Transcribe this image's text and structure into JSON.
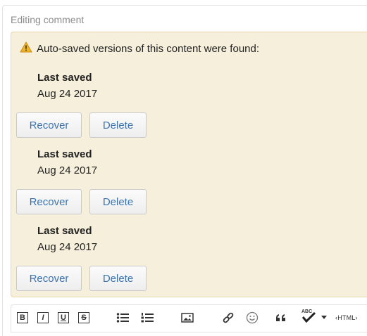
{
  "editor": {
    "title": "Editing comment"
  },
  "notice": {
    "message": "Auto-saved versions of this content were found:",
    "versions": [
      {
        "label": "Last saved",
        "date": "Aug 24 2017",
        "recover_label": "Recover",
        "delete_label": "Delete"
      },
      {
        "label": "Last saved",
        "date": "Aug 24 2017",
        "recover_label": "Recover",
        "delete_label": "Delete"
      },
      {
        "label": "Last saved",
        "date": "Aug 24 2017",
        "recover_label": "Recover",
        "delete_label": "Delete"
      }
    ]
  },
  "toolbar": {
    "bold": "B",
    "italic": "I",
    "underline": "U",
    "strike": "S",
    "html_label": "‹HTML›",
    "icons": [
      "bold-icon",
      "italic-icon",
      "underline-icon",
      "strikethrough-icon",
      "bullet-list-icon",
      "numbered-list-icon",
      "image-icon",
      "link-icon",
      "emoji-icon",
      "quote-icon",
      "spellcheck-icon",
      "chevron-down-icon",
      "html-source-icon"
    ]
  },
  "colors": {
    "notice_bg": "#f6efdb",
    "link_blue": "#3b73af",
    "warning": "#f0b429"
  }
}
